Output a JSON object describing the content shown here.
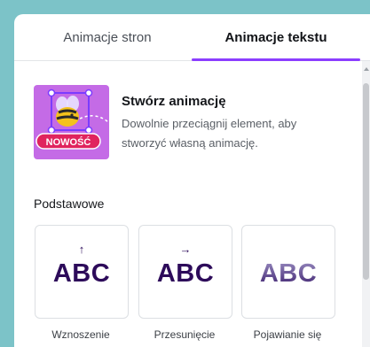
{
  "tabs": [
    {
      "label": "Animacje stron"
    },
    {
      "label": "Animacje tekstu"
    }
  ],
  "promo": {
    "title": "Stwórz animację",
    "description": "Dowolnie przeciągnij element, aby stworzyć własną animację.",
    "badge": "NOWOŚĆ"
  },
  "section": {
    "title": "Podstawowe"
  },
  "cards": [
    {
      "arrow": "↑",
      "sample": "ABC",
      "label": "Wznoszenie"
    },
    {
      "arrow": "→",
      "sample": "ABC",
      "label": "Przesunięcie"
    },
    {
      "arrow": "",
      "sample": "ABC",
      "label": "Pojawianie się"
    }
  ],
  "colors": {
    "accent": "#8b3dff",
    "promo_bg": "#c46be6",
    "badge": "#e0245e",
    "abc_text": "#2d0b5a"
  }
}
